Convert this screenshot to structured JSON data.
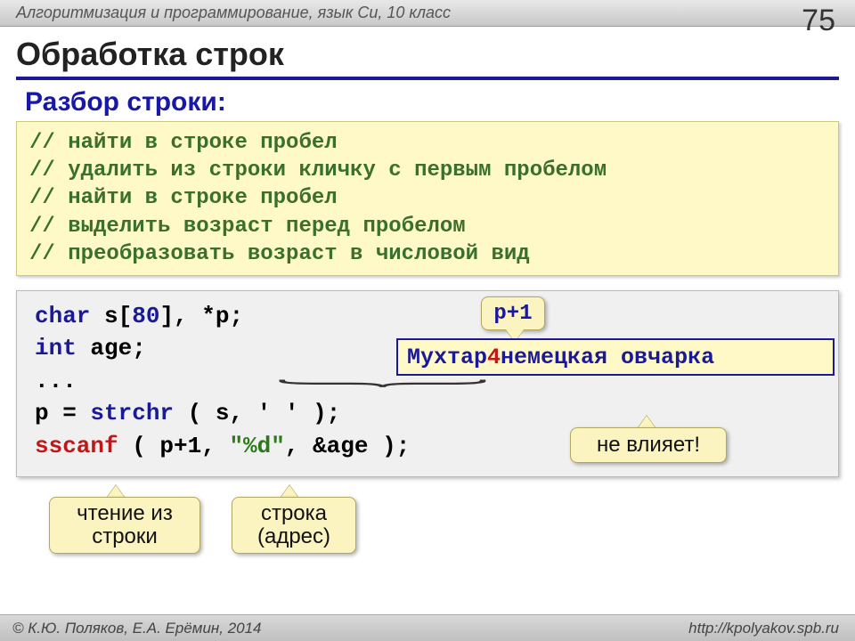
{
  "header": {
    "breadcrumb": "Алгоритмизация и программирование, язык Си, 10 класс",
    "page_num": "75"
  },
  "title": "Обработка строк",
  "subtitle": "Разбор строки:",
  "comments": {
    "l1": "// найти в строке пробел",
    "l2": "// удалить из строки кличку с первым пробелом",
    "l3": "// найти в строке пробел",
    "l4": "// выделить возраст перед пробелом",
    "l5": "// преобразовать возраст в числовой вид"
  },
  "code": {
    "kw_char": "char",
    "decl_rest": " s[",
    "size": "80",
    "decl_end": "], *p;",
    "kw_int": "int",
    "int_rest": " age;",
    "dots": "...",
    "p_eq": "p = ",
    "strchr": "strchr",
    "strchr_args": " ( s, ' ' );",
    "sscanf": "sscanf",
    "ss_open": " ( p+1, ",
    "fmt": "\"%d\"",
    "ss_close": ", &age );"
  },
  "example": {
    "name": "Мухтар ",
    "age": "4",
    "rest": " немецкая овчарка"
  },
  "callouts": {
    "p1": "p+1",
    "not_affect": "не влияет!",
    "read_l1": "чтение из",
    "read_l2": "строки",
    "addr_l1": "строка",
    "addr_l2": "(адрес)"
  },
  "footer": {
    "copyright": "© К.Ю. Поляков, Е.А. Ерёмин, 2014",
    "url": "http://kpolyakov.spb.ru"
  }
}
